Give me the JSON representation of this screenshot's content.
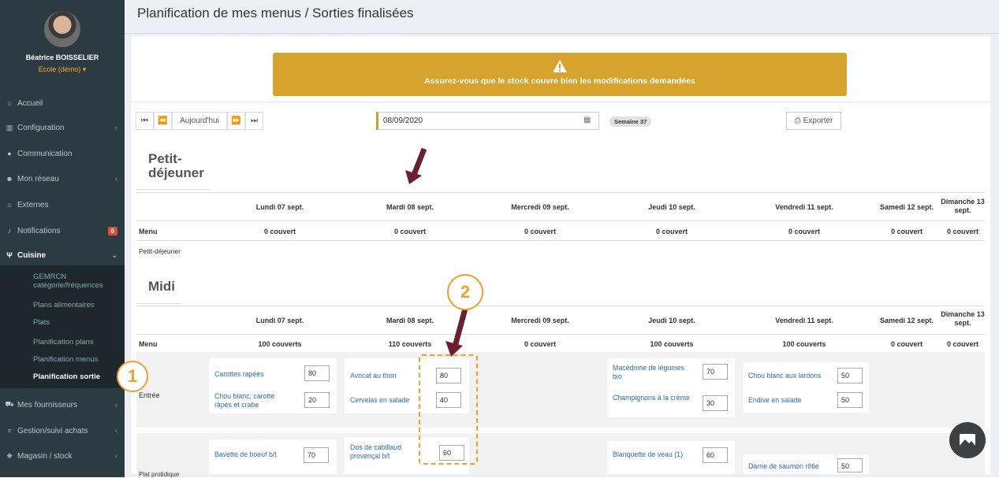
{
  "user": {
    "name": "Béatrice BOISSELIER",
    "school": "Ecole (démo) ▾"
  },
  "sidebar": {
    "items": [
      {
        "label": "Accueil",
        "icon": "home-icon"
      },
      {
        "label": "Configuration",
        "icon": "bank-icon"
      },
      {
        "label": "Communication",
        "icon": "chat-icon"
      },
      {
        "label": "Mon réseau",
        "icon": "users-icon"
      },
      {
        "label": "Externes",
        "icon": "home-icon"
      },
      {
        "label": "Notifications",
        "icon": "bell-icon",
        "badge": "6"
      },
      {
        "label": "Cuisine",
        "icon": "cutlery-icon"
      },
      {
        "label": "Mes fournisseurs",
        "icon": "truck-icon"
      },
      {
        "label": "Gestion/suivi achats",
        "icon": "cart-icon"
      },
      {
        "label": "Magasin / stock",
        "icon": "cubes-icon"
      }
    ],
    "submenu": [
      "GEMRCN catégorie/fréquences",
      "Plans alimentaires",
      "Plats",
      "Planification plans",
      "Planification menus",
      "Planification sortie"
    ]
  },
  "page": {
    "title": "Planification de mes menus / Sorties finalisées"
  },
  "warning": {
    "text": "Assurez-vous que le stock couvre bien les modifications demandées",
    "color": "#d6a42c"
  },
  "toolbar": {
    "today_label": "Aujourd'hui",
    "date_value": "08/09/2020",
    "week_badge": "Semaine 37",
    "export_label": "Exporter"
  },
  "days": [
    "Lundi 07 sept.",
    "Mardi 08 sept.",
    "Mercredi 09 sept.",
    "Jeudi 10 sept.",
    "Vendredi 11 sept.",
    "Samedi 12 sept.",
    "Dimanche 13 sept."
  ],
  "petit_dejeuner": {
    "title": "Petit-déjeuner",
    "menu_label": "Menu",
    "covers": [
      "0 couvert",
      "0 couvert",
      "0 couvert",
      "0 couvert",
      "0 couvert",
      "0 couvert",
      "0 couvert"
    ],
    "row_label": "Petit-déjeuner"
  },
  "midi": {
    "title": "Midi",
    "menu_label": "Menu",
    "covers": [
      "100 couverts",
      "110 couverts",
      "0 couvert",
      "100 couverts",
      "100 couverts",
      "0 couvert",
      "0 couvert"
    ],
    "entree_label": "Entrée",
    "plat_label": "Plat protidique",
    "entree": {
      "lundi": [
        {
          "name": "Carottes rapées",
          "qty": "80"
        },
        {
          "name": "Chou blanc, carotte râpés et crabe",
          "qty": "20"
        }
      ],
      "mardi": [
        {
          "name": "Avocat au thon",
          "qty": "80"
        },
        {
          "name": "Cervelas en salade",
          "qty": "40"
        }
      ],
      "jeudi": [
        {
          "name": "Macédoine de légumes bio",
          "qty": "70"
        },
        {
          "name": "Champignons à la crème",
          "qty": "30"
        }
      ],
      "vendredi": [
        {
          "name": "Chou blanc aux lardons",
          "qty": "50"
        },
        {
          "name": "Endive en salade",
          "qty": "50"
        }
      ]
    },
    "plat": {
      "lundi": [
        {
          "name": "Bavette de boeuf b/t",
          "qty": "70"
        }
      ],
      "mardi": [
        {
          "name": "Dos de cabillaud provençal b/t",
          "qty": "60"
        }
      ],
      "jeudi": [
        {
          "name": "Blanquette de veau (1)",
          "qty": "60"
        }
      ],
      "vendredi": [
        {
          "name": "Darne de saumon rôtie",
          "qty": "50"
        }
      ]
    }
  },
  "annotations": {
    "callout_1": "1",
    "callout_2": "2",
    "accent": "#f0a030",
    "arrow": "#6b2031"
  }
}
